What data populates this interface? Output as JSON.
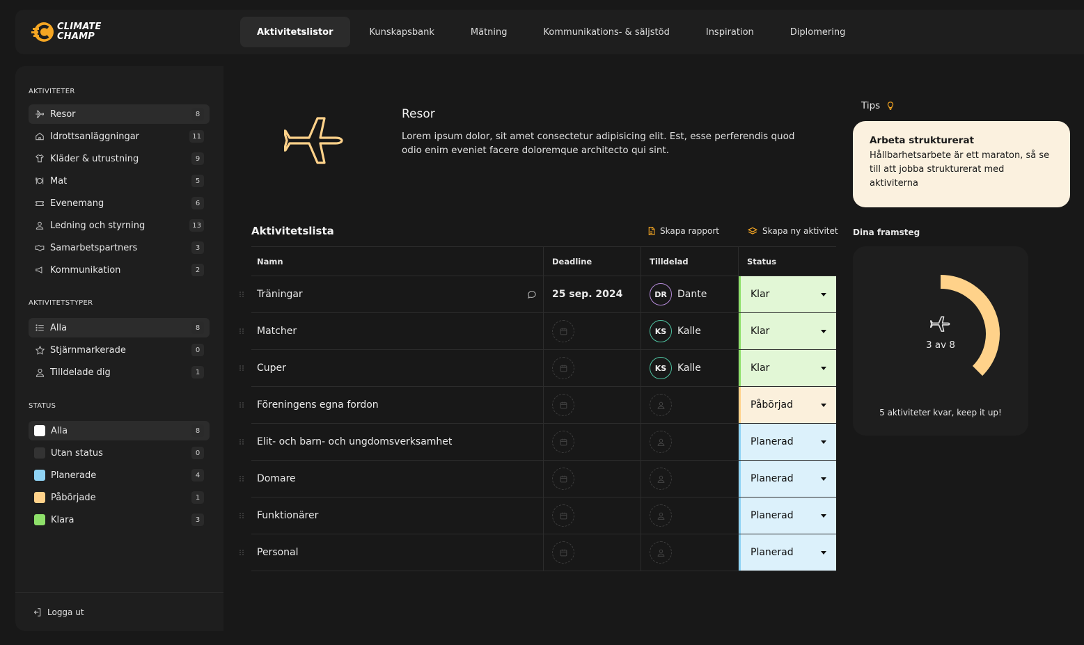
{
  "brand": {
    "line1": "CLIMATE",
    "line2": "CHAMP",
    "accent": "#f5a623"
  },
  "nav": [
    {
      "label": "Aktivitetslistor",
      "active": true
    },
    {
      "label": "Kunskapsbank"
    },
    {
      "label": "Mätning"
    },
    {
      "label": "Kommunikations- & säljstöd"
    },
    {
      "label": "Inspiration"
    },
    {
      "label": "Diplomering"
    }
  ],
  "sidebar": {
    "activities_title": "AKTIVITETER",
    "activities": [
      {
        "label": "Resor",
        "count": "8",
        "icon": "airplane-icon"
      },
      {
        "label": "Idrottsanläggningar",
        "count": "11",
        "icon": "house-icon"
      },
      {
        "label": "Kläder & utrustning",
        "count": "9",
        "icon": "shirt-icon"
      },
      {
        "label": "Mat",
        "count": "5",
        "icon": "plate-icon"
      },
      {
        "label": "Evenemang",
        "count": "6",
        "icon": "ticket-icon"
      },
      {
        "label": "Ledning och styrning",
        "count": "13",
        "icon": "person-icon"
      },
      {
        "label": "Samarbetspartners",
        "count": "3",
        "icon": "handshake-icon"
      },
      {
        "label": "Kommunikation",
        "count": "2",
        "icon": "megaphone-icon"
      }
    ],
    "types_title": "AKTIVITETSTYPER",
    "types": [
      {
        "label": "Alla",
        "count": "8",
        "icon": "list-icon"
      },
      {
        "label": "Stjärnmarkerade",
        "count": "0",
        "icon": "star-icon"
      },
      {
        "label": "Tilldelade dig",
        "count": "1",
        "icon": "user-icon"
      }
    ],
    "status_title": "STATUS",
    "statuses": [
      {
        "label": "Alla",
        "count": "8",
        "color": "#ffffff"
      },
      {
        "label": "Utan status",
        "count": "0",
        "color": "#333333"
      },
      {
        "label": "Planerade",
        "count": "4",
        "color": "#8fd3f4"
      },
      {
        "label": "Påbörjade",
        "count": "1",
        "color": "#ffd28a"
      },
      {
        "label": "Klara",
        "count": "3",
        "color": "#8ee06a"
      }
    ],
    "logout": "Logga ut"
  },
  "hero": {
    "title": "Resor",
    "description": "Lorem ipsum dolor, sit amet consectetur adipisicing elit. Est, esse perferendis quod odio enim eveniet facere doloremque architecto qui sint."
  },
  "tips": {
    "label": "Tips",
    "card_title": "Arbeta strukturerat",
    "card_text": "Hållbarhetsarbete är ett maraton, så se till att jobba strukturerat med aktiviterna"
  },
  "list": {
    "title": "Aktivitetslista",
    "create_report": "Skapa rapport",
    "create_activity": "Skapa ny aktivitet",
    "headers": {
      "name": "Namn",
      "deadline": "Deadline",
      "assigned": "Tilldelad",
      "status": "Status"
    },
    "rows": [
      {
        "name": "Träningar",
        "deadline": "25 sep. 2024",
        "initials": "DR",
        "assignee": "Dante",
        "avatar_color": "#b48ad8",
        "status": "Klar",
        "status_key": "done",
        "comment": true
      },
      {
        "name": "Matcher",
        "deadline": "",
        "initials": "KS",
        "assignee": "Kalle",
        "avatar_color": "#4fc3a1",
        "status": "Klar",
        "status_key": "done"
      },
      {
        "name": "Cuper",
        "deadline": "",
        "initials": "KS",
        "assignee": "Kalle",
        "avatar_color": "#4fc3a1",
        "status": "Klar",
        "status_key": "done"
      },
      {
        "name": "Föreningens egna fordon",
        "deadline": "",
        "initials": "",
        "assignee": "",
        "status": "Påbörjad",
        "status_key": "started"
      },
      {
        "name": "Elit- och barn- och ungdomsverksamhet",
        "deadline": "",
        "initials": "",
        "assignee": "",
        "status": "Planerad",
        "status_key": "planned"
      },
      {
        "name": "Domare",
        "deadline": "",
        "initials": "",
        "assignee": "",
        "status": "Planerad",
        "status_key": "planned"
      },
      {
        "name": "Funktionärer",
        "deadline": "",
        "initials": "",
        "assignee": "",
        "status": "Planerad",
        "status_key": "planned"
      },
      {
        "name": "Personal",
        "deadline": "",
        "initials": "",
        "assignee": "",
        "status": "Planerad",
        "status_key": "planned"
      }
    ]
  },
  "status_colors": {
    "done": {
      "bg": "#e2f7d6",
      "bar": "#8ee06a"
    },
    "started": {
      "bg": "#fbf0dc",
      "bar": "#ffd28a"
    },
    "planned": {
      "bg": "#dcf1fb",
      "bar": "#8fd3f4"
    }
  },
  "progress": {
    "label": "Dina framsteg",
    "count_text": "3 av 8",
    "done": 3,
    "total": 8,
    "footer": "5 aktiviteter kvar, keep it up!",
    "color": "#ffd28a"
  }
}
